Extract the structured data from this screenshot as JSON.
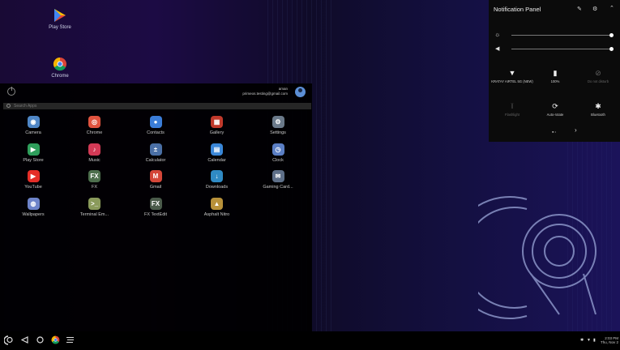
{
  "desktop": {
    "icons": [
      {
        "label": "Play Store",
        "icon": "play-store-icon"
      },
      {
        "label": "Chrome",
        "icon": "chrome-icon"
      }
    ]
  },
  "drawer": {
    "user_name": "aman",
    "user_email": "primeos.testing@gmail.com",
    "search_placeholder": "Search Apps",
    "apps": [
      {
        "label": "Camera",
        "color": "#4f86c6",
        "glyph": "◉"
      },
      {
        "label": "Chrome",
        "color": "#e0533f",
        "glyph": "◎"
      },
      {
        "label": "Contacts",
        "color": "#3b7dd8",
        "glyph": "●"
      },
      {
        "label": "Gallery",
        "color": "#c0392b",
        "glyph": "▦"
      },
      {
        "label": "Settings",
        "color": "#6b7a8a",
        "glyph": "⚙"
      },
      {
        "label": "Play Store",
        "color": "#2e9e5b",
        "glyph": "▶"
      },
      {
        "label": "Music",
        "color": "#d33a56",
        "glyph": "♪"
      },
      {
        "label": "Calculator",
        "color": "#4a6fa5",
        "glyph": "±"
      },
      {
        "label": "Calendar",
        "color": "#3a87d8",
        "glyph": "▤"
      },
      {
        "label": "Clock",
        "color": "#5b7fc4",
        "glyph": "◷"
      },
      {
        "label": "YouTube",
        "color": "#e52d27",
        "glyph": "▶"
      },
      {
        "label": "FX",
        "color": "#4d6f4d",
        "glyph": "FX"
      },
      {
        "label": "Gmail",
        "color": "#d44638",
        "glyph": "M"
      },
      {
        "label": "Downloads",
        "color": "#2f8ac4",
        "glyph": "↓"
      },
      {
        "label": "Gaming Card...",
        "color": "#5e6f88",
        "glyph": "✉"
      },
      {
        "label": "Wallpapers",
        "color": "#6d83c9",
        "glyph": "◍"
      },
      {
        "label": "Terminal Em...",
        "color": "#8a9a5b",
        "glyph": ">_"
      },
      {
        "label": "FX TextEdit",
        "color": "#4a5a4a",
        "glyph": "FX"
      },
      {
        "label": "Asphalt Nitro",
        "color": "#b8913a",
        "glyph": "▲"
      }
    ]
  },
  "panel": {
    "title": "Notification Panel",
    "icons": {
      "edit": "pencil-icon",
      "settings": "gear-icon",
      "collapse": "chevron-up-icon"
    },
    "tiles": [
      {
        "label": "KRATAY AIRTEL 5G (NEW)",
        "icon": "wifi-icon",
        "glyph": "▼",
        "active": true
      },
      {
        "label": "100%",
        "icon": "battery-icon",
        "glyph": "▮",
        "active": true
      },
      {
        "label": "Do not disturb",
        "icon": "dnd-icon",
        "glyph": "⊘",
        "active": false
      },
      {
        "label": "Flashlight",
        "icon": "flashlight-icon",
        "glyph": "ǐ",
        "active": false
      },
      {
        "label": "Auto-rotate",
        "icon": "rotate-icon",
        "glyph": "⟳",
        "active": true
      },
      {
        "label": "Bluetooth",
        "icon": "bluetooth-icon",
        "glyph": "✱",
        "active": true
      }
    ],
    "brightness": 1.0,
    "volume": 1.0
  },
  "taskbar": {
    "time": "2:03 PM",
    "date": "Thu, Nov 2"
  },
  "colors": {
    "accent": "#ffffff",
    "panel_bg": "#0b0b0b",
    "drawer_bg": "#000000"
  }
}
